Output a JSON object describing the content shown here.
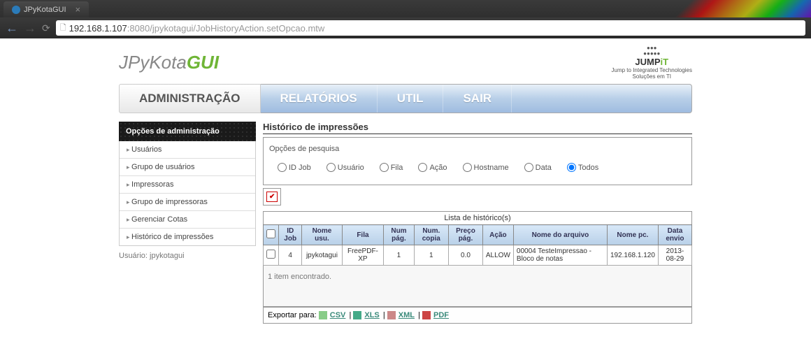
{
  "browser": {
    "tab_title": "JPyKotaGUI",
    "url_host": "192.168.1.107",
    "url_port": ":8080",
    "url_path": "/jpykotagui/JobHistoryAction.setOpcao.mtw"
  },
  "logo": {
    "part1": "JPyKota",
    "part2": "GUI"
  },
  "jump_logo": {
    "name1": "JUMP",
    "name2": "iT",
    "tagline": "Jump to Integrated Technologies",
    "sub": "Soluções em TI"
  },
  "main_nav": [
    {
      "label": "ADMINISTRAÇÃO",
      "active": true
    },
    {
      "label": "RELATÓRIOS",
      "active": false
    },
    {
      "label": "UTIL",
      "active": false
    },
    {
      "label": "SAIR",
      "active": false
    }
  ],
  "sidebar": {
    "header": "Opções de administração",
    "items": [
      "Usuários",
      "Grupo de usuários",
      "Impressoras",
      "Grupo de impressoras",
      "Gerenciar Cotas",
      "Histórico de impressões"
    ]
  },
  "user_label": "Usuário: jpykotagui",
  "section_title": "Histórico de impressões",
  "search": {
    "label": "Opções de pesquisa",
    "options": [
      "ID Job",
      "Usuário",
      "Fila",
      "Ação",
      "Hostname",
      "Data",
      "Todos"
    ],
    "selected": "Todos"
  },
  "list_title": "Lista de histórico(s)",
  "table": {
    "headers": [
      "",
      "ID Job",
      "Nome usu.",
      "Fila",
      "Num pág.",
      "Num. copia",
      "Preço pág.",
      "Ação",
      "Nome do arquivo",
      "Nome pc.",
      "Data envio"
    ],
    "rows": [
      {
        "id": "4",
        "user": "jpykotagui",
        "queue": "FreePDF-XP",
        "pages": "1",
        "copies": "1",
        "price": "0.0",
        "action": "ALLOW",
        "file": "00004 TesteImpressao - Bloco de notas",
        "pc": "192.168.1.120",
        "date": "2013-08-29"
      }
    ]
  },
  "footer_msg": "1 item encontrado.",
  "export": {
    "label": "Exportar para:",
    "formats": [
      "CSV",
      "XLS",
      "XML",
      "PDF"
    ]
  }
}
